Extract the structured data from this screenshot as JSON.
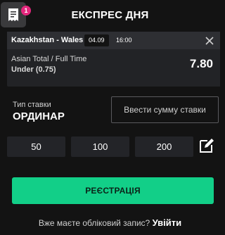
{
  "header": {
    "title": "ЕКСПРЕС ДНЯ",
    "slip_badge_count": "1"
  },
  "bet": {
    "match": "Kazakhstan - Wales",
    "date": "04.09",
    "time": "16:00",
    "market": "Asian Total / Full Time",
    "selection": "Under (0.75)",
    "odds": "7.80"
  },
  "bet_type": {
    "label": "Тип ставки",
    "value": "ОРДИНАР"
  },
  "stake": {
    "placeholder": "Ввести сумму ставки",
    "quick_amounts": [
      "50",
      "100",
      "200"
    ]
  },
  "register_label": "РЕЄСТРАЦІЯ",
  "footer": {
    "prompt": "Вже маєте обліковий запис?",
    "login_label": "Увійти"
  },
  "colors": {
    "accent": "#12cf88",
    "badge": "#e4277d",
    "background": "#131313"
  },
  "icons": [
    "bet-slip-icon",
    "close-icon",
    "edit-icon"
  ]
}
